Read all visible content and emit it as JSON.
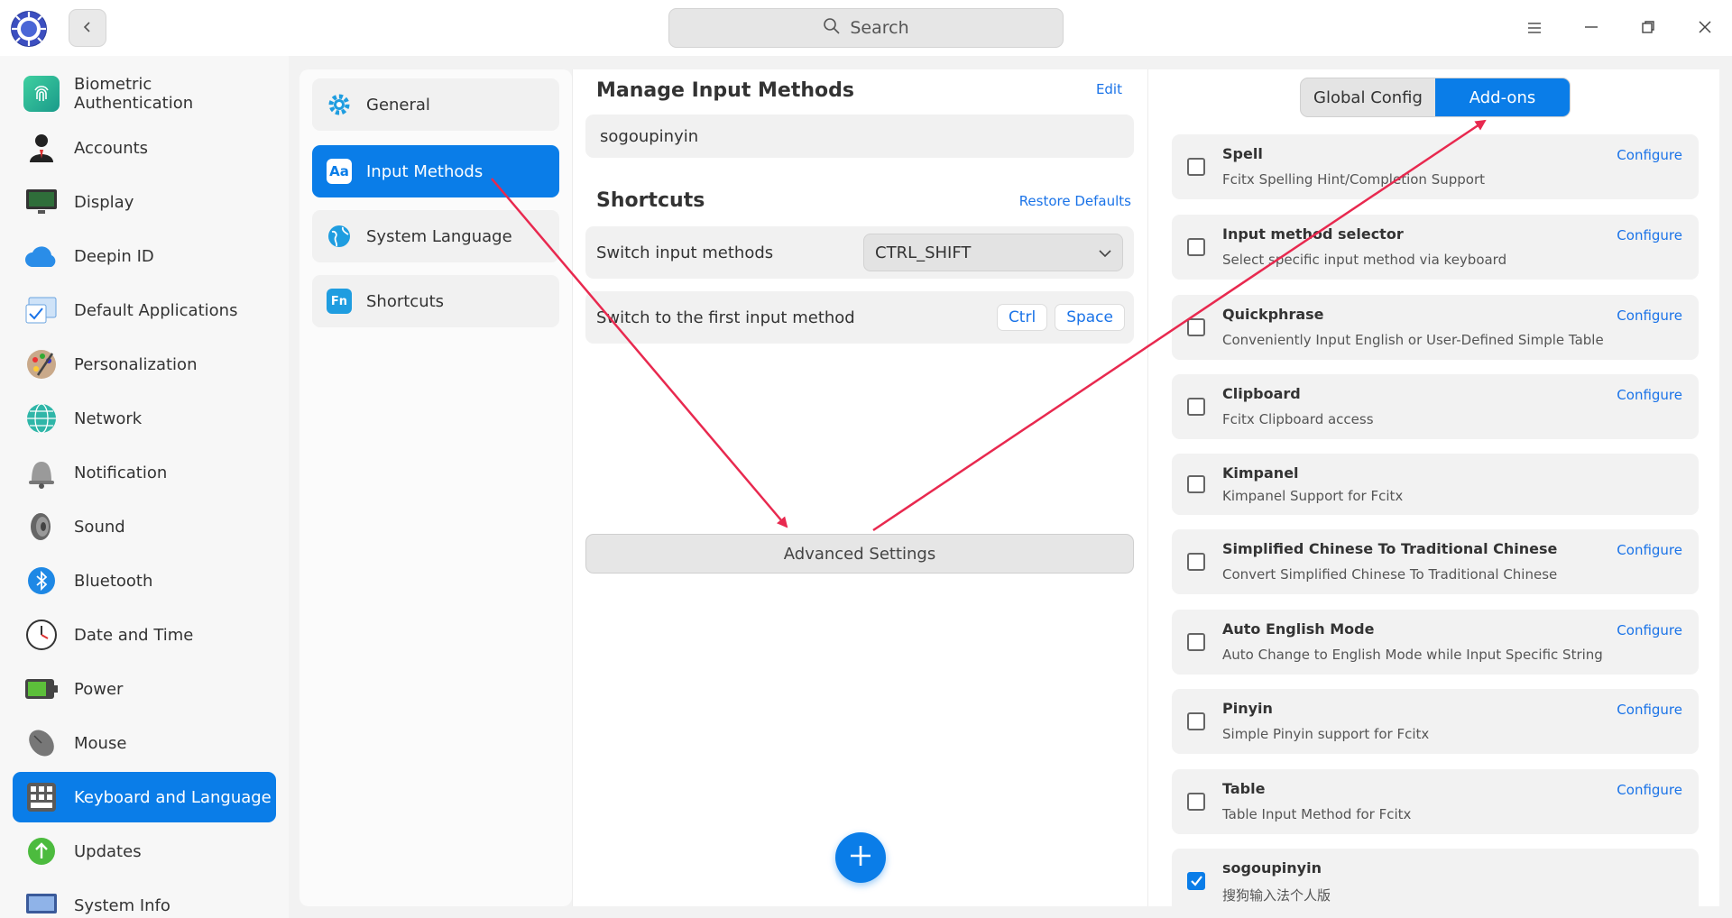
{
  "titlebar": {
    "search_placeholder": "Search"
  },
  "sidebar": {
    "items": [
      {
        "label": "Biometric Authentication",
        "icon": "fingerprint-icon"
      },
      {
        "label": "Accounts",
        "icon": "user-icon"
      },
      {
        "label": "Display",
        "icon": "monitor-icon"
      },
      {
        "label": "Deepin ID",
        "icon": "cloud-icon"
      },
      {
        "label": "Default Applications",
        "icon": "apps-icon"
      },
      {
        "label": "Personalization",
        "icon": "palette-icon"
      },
      {
        "label": "Network",
        "icon": "network-icon"
      },
      {
        "label": "Notification",
        "icon": "bell-icon"
      },
      {
        "label": "Sound",
        "icon": "speaker-icon"
      },
      {
        "label": "Bluetooth",
        "icon": "bluetooth-icon"
      },
      {
        "label": "Date and Time",
        "icon": "clock-icon"
      },
      {
        "label": "Power",
        "icon": "battery-icon"
      },
      {
        "label": "Mouse",
        "icon": "mouse-icon"
      },
      {
        "label": "Keyboard and Language",
        "icon": "keyboard-icon",
        "active": true
      },
      {
        "label": "Updates",
        "icon": "update-arrow-icon"
      },
      {
        "label": "System Info",
        "icon": "system-info-icon"
      }
    ]
  },
  "categories": {
    "items": [
      {
        "label": "General",
        "icon": "gear-icon"
      },
      {
        "label": "Input Methods",
        "icon": "input-method-icon",
        "active": true
      },
      {
        "label": "System Language",
        "icon": "globe-icon"
      },
      {
        "label": "Shortcuts",
        "icon": "fn-key-icon"
      }
    ]
  },
  "main": {
    "manage_title": "Manage Input Methods",
    "edit_label": "Edit",
    "current_method": "sogoupinyin",
    "shortcuts_title": "Shortcuts",
    "restore_label": "Restore Defaults",
    "switch_label": "Switch input methods",
    "switch_value": "CTRL_SHIFT",
    "first_label": "Switch to the first input method",
    "key1": "Ctrl",
    "key2": "Space",
    "advanced_label": "Advanced Settings"
  },
  "addons_panel": {
    "tab_global": "Global Config",
    "tab_addons": "Add-ons",
    "configure_label": "Configure",
    "items": [
      {
        "name": "Spell",
        "desc": "Fcitx Spelling Hint/Completion Support",
        "configure": true,
        "checked": false
      },
      {
        "name": "Input method selector",
        "desc": "Select specific input method via keyboard",
        "configure": true,
        "checked": false
      },
      {
        "name": "Quickphrase",
        "desc": "Conveniently Input English or User-Defined Simple Table",
        "configure": true,
        "checked": false
      },
      {
        "name": "Clipboard",
        "desc": "Fcitx Clipboard access",
        "configure": true,
        "checked": false
      },
      {
        "name": "Kimpanel",
        "desc": "Kimpanel Support for Fcitx",
        "configure": false,
        "checked": false
      },
      {
        "name": "Simplified Chinese To Traditional Chinese",
        "desc": "Convert Simplified Chinese To Traditional Chinese",
        "configure": true,
        "checked": false
      },
      {
        "name": "Auto English Mode",
        "desc": "Auto Change to English Mode while Input Specific String",
        "configure": true,
        "checked": false
      },
      {
        "name": "Pinyin",
        "desc": "Simple Pinyin support for Fcitx",
        "configure": true,
        "checked": false
      },
      {
        "name": "Table",
        "desc": "Table Input Method for Fcitx",
        "configure": true,
        "checked": false
      },
      {
        "name": "sogoupinyin",
        "desc": "搜狗输入法个人版",
        "configure": false,
        "checked": true
      }
    ]
  },
  "colors": {
    "accent": "#0a7de8",
    "annotation": "#e8294f"
  }
}
